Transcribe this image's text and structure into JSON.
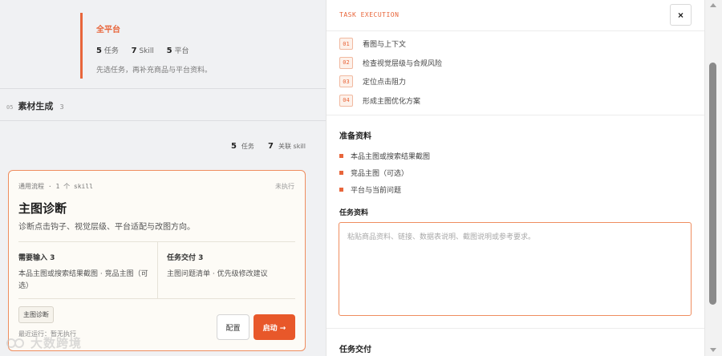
{
  "platform_card": {
    "title": "全平台",
    "tasks_num": "5",
    "tasks_label": "任务",
    "skills_num": "7",
    "skills_label": "Skill",
    "platforms_num": "5",
    "platforms_label": "平台",
    "hint": "先选任务，再补充商品与平台资料。"
  },
  "section": {
    "number": "05",
    "title": "素材生成",
    "count": "3"
  },
  "summary": {
    "tasks_num": "5",
    "tasks_label": "任务",
    "skills_num": "7",
    "skills_label": "关联 skill"
  },
  "task_card": {
    "meta": "通用流程 · 1 个 skill",
    "status": "未执行",
    "title": "主图诊断",
    "description": "诊断点击钩子、视觉层级、平台适配与改图方向。",
    "inputs_heading": "需要输入 3",
    "inputs_body": "本品主图或搜索结果截图 · 竞品主图（可选）",
    "outputs_heading": "任务交付 3",
    "outputs_body": "主图问题清单 · 优先级修改建议",
    "tag": "主图诊断",
    "footer": "最近运行：暂无执行",
    "config_button": "配置",
    "start_button": "启动 →"
  },
  "watermark": {
    "text": "大数跨境"
  },
  "execution": {
    "label": "TASK EXECUTION",
    "close": "×",
    "steps": [
      {
        "num": "01",
        "label": "看图与上下文"
      },
      {
        "num": "02",
        "label": "检查视觉层级与合规风险"
      },
      {
        "num": "03",
        "label": "定位点击阻力"
      },
      {
        "num": "04",
        "label": "形成主图优化方案"
      }
    ],
    "prep_title": "准备资料",
    "prep_items": [
      "本品主图或搜索结果截图",
      "竞品主图（可选）",
      "平台与当前问题"
    ],
    "materials_title": "任务资料",
    "materials_placeholder": "粘贴商品资料、链接、数据表说明、截图说明或参考要求。",
    "deliver_title": "任务交付"
  },
  "colors": {
    "accent": "#e8663b",
    "start_button": "#e8582a",
    "card_border": "#ef8d5f",
    "card_background": "#fdfbf6"
  }
}
